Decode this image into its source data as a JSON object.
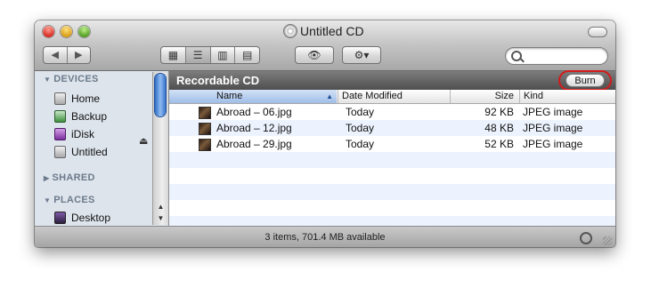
{
  "window": {
    "title": "Untitled CD"
  },
  "toolbar": {
    "back_label": "◀",
    "forward_label": "▶",
    "view_icons": "▦",
    "view_list": "☰",
    "view_columns": "▥",
    "view_coverflow": "▤",
    "quicklook_label": "👁",
    "action_label": "⚙▾",
    "search_placeholder": ""
  },
  "sidebar": {
    "devices_header": "DEVICES",
    "devices": [
      {
        "label": "Home",
        "icon": "hard-drive-icon"
      },
      {
        "label": "Backup",
        "icon": "backup-drive-icon"
      },
      {
        "label": "iDisk",
        "icon": "idisk-icon"
      },
      {
        "label": "Untitled",
        "icon": "disc-drive-icon"
      }
    ],
    "shared_header": "SHARED",
    "places_header": "PLACES",
    "places": [
      {
        "label": "Desktop",
        "icon": "desktop-icon"
      }
    ]
  },
  "main": {
    "header_title": "Recordable CD",
    "burn_label": "Burn",
    "columns": {
      "name": "Name",
      "date": "Date Modified",
      "size": "Size",
      "kind": "Kind"
    },
    "files": [
      {
        "name": "Abroad – 06.jpg",
        "date": "Today",
        "size": "92 KB",
        "kind": "JPEG image"
      },
      {
        "name": "Abroad – 12.jpg",
        "date": "Today",
        "size": "48 KB",
        "kind": "JPEG image"
      },
      {
        "name": "Abroad – 29.jpg",
        "date": "Today",
        "size": "52 KB",
        "kind": "JPEG image"
      }
    ]
  },
  "status": {
    "text": "3 items, 701.4 MB available"
  },
  "colors": {
    "highlight_ring": "#d41a1a",
    "sidebar_bg": "#dde4ec",
    "alt_row": "#edf3fe"
  }
}
